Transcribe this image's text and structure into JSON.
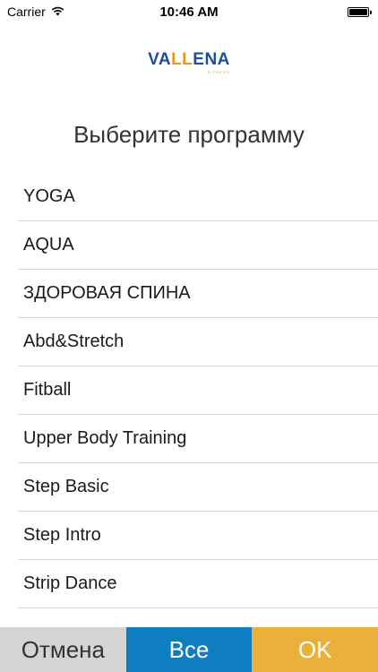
{
  "status_bar": {
    "carrier": "Carrier",
    "time": "10:46 AM",
    "wifi_icon": "wifi-icon",
    "battery_icon": "battery-icon",
    "battery_level": 1.0
  },
  "logo": {
    "part_va": "VA",
    "part_ll": "LL",
    "part_ena": "ENA",
    "subtitle": "FITNESS",
    "colors": {
      "blue": "#1e4f9b",
      "orange": "#e89a1e"
    }
  },
  "header": {
    "title": "Выберите программу"
  },
  "programs": [
    {
      "label": "YOGA"
    },
    {
      "label": "AQUA"
    },
    {
      "label": "ЗДОРОВАЯ СПИНА"
    },
    {
      "label": "Abd&Stretch"
    },
    {
      "label": "Fitball"
    },
    {
      "label": "Upper Body Training"
    },
    {
      "label": "Step Basic"
    },
    {
      "label": "Step Intro"
    },
    {
      "label": "Strip Dance"
    }
  ],
  "footer": {
    "cancel_label": "Отмена",
    "all_label": "Все",
    "ok_label": "OK",
    "colors": {
      "cancel": "#d4d4d4",
      "all": "#0f7ec1",
      "ok": "#eab03a"
    }
  }
}
